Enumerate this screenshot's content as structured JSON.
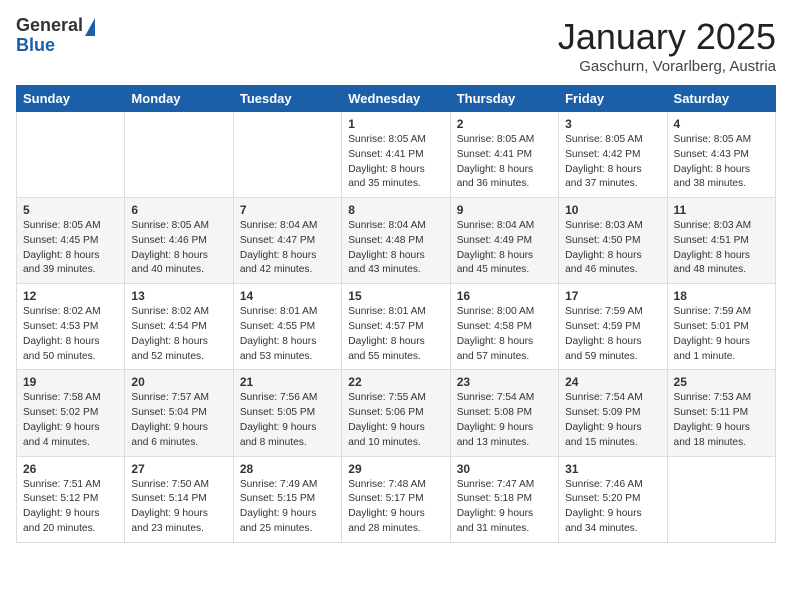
{
  "header": {
    "logo_general": "General",
    "logo_blue": "Blue",
    "month": "January 2025",
    "location": "Gaschurn, Vorarlberg, Austria"
  },
  "weekdays": [
    "Sunday",
    "Monday",
    "Tuesday",
    "Wednesday",
    "Thursday",
    "Friday",
    "Saturday"
  ],
  "weeks": [
    [
      {
        "day": "",
        "text": ""
      },
      {
        "day": "",
        "text": ""
      },
      {
        "day": "",
        "text": ""
      },
      {
        "day": "1",
        "text": "Sunrise: 8:05 AM\nSunset: 4:41 PM\nDaylight: 8 hours and 35 minutes."
      },
      {
        "day": "2",
        "text": "Sunrise: 8:05 AM\nSunset: 4:41 PM\nDaylight: 8 hours and 36 minutes."
      },
      {
        "day": "3",
        "text": "Sunrise: 8:05 AM\nSunset: 4:42 PM\nDaylight: 8 hours and 37 minutes."
      },
      {
        "day": "4",
        "text": "Sunrise: 8:05 AM\nSunset: 4:43 PM\nDaylight: 8 hours and 38 minutes."
      }
    ],
    [
      {
        "day": "5",
        "text": "Sunrise: 8:05 AM\nSunset: 4:45 PM\nDaylight: 8 hours and 39 minutes."
      },
      {
        "day": "6",
        "text": "Sunrise: 8:05 AM\nSunset: 4:46 PM\nDaylight: 8 hours and 40 minutes."
      },
      {
        "day": "7",
        "text": "Sunrise: 8:04 AM\nSunset: 4:47 PM\nDaylight: 8 hours and 42 minutes."
      },
      {
        "day": "8",
        "text": "Sunrise: 8:04 AM\nSunset: 4:48 PM\nDaylight: 8 hours and 43 minutes."
      },
      {
        "day": "9",
        "text": "Sunrise: 8:04 AM\nSunset: 4:49 PM\nDaylight: 8 hours and 45 minutes."
      },
      {
        "day": "10",
        "text": "Sunrise: 8:03 AM\nSunset: 4:50 PM\nDaylight: 8 hours and 46 minutes."
      },
      {
        "day": "11",
        "text": "Sunrise: 8:03 AM\nSunset: 4:51 PM\nDaylight: 8 hours and 48 minutes."
      }
    ],
    [
      {
        "day": "12",
        "text": "Sunrise: 8:02 AM\nSunset: 4:53 PM\nDaylight: 8 hours and 50 minutes."
      },
      {
        "day": "13",
        "text": "Sunrise: 8:02 AM\nSunset: 4:54 PM\nDaylight: 8 hours and 52 minutes."
      },
      {
        "day": "14",
        "text": "Sunrise: 8:01 AM\nSunset: 4:55 PM\nDaylight: 8 hours and 53 minutes."
      },
      {
        "day": "15",
        "text": "Sunrise: 8:01 AM\nSunset: 4:57 PM\nDaylight: 8 hours and 55 minutes."
      },
      {
        "day": "16",
        "text": "Sunrise: 8:00 AM\nSunset: 4:58 PM\nDaylight: 8 hours and 57 minutes."
      },
      {
        "day": "17",
        "text": "Sunrise: 7:59 AM\nSunset: 4:59 PM\nDaylight: 8 hours and 59 minutes."
      },
      {
        "day": "18",
        "text": "Sunrise: 7:59 AM\nSunset: 5:01 PM\nDaylight: 9 hours and 1 minute."
      }
    ],
    [
      {
        "day": "19",
        "text": "Sunrise: 7:58 AM\nSunset: 5:02 PM\nDaylight: 9 hours and 4 minutes."
      },
      {
        "day": "20",
        "text": "Sunrise: 7:57 AM\nSunset: 5:04 PM\nDaylight: 9 hours and 6 minutes."
      },
      {
        "day": "21",
        "text": "Sunrise: 7:56 AM\nSunset: 5:05 PM\nDaylight: 9 hours and 8 minutes."
      },
      {
        "day": "22",
        "text": "Sunrise: 7:55 AM\nSunset: 5:06 PM\nDaylight: 9 hours and 10 minutes."
      },
      {
        "day": "23",
        "text": "Sunrise: 7:54 AM\nSunset: 5:08 PM\nDaylight: 9 hours and 13 minutes."
      },
      {
        "day": "24",
        "text": "Sunrise: 7:54 AM\nSunset: 5:09 PM\nDaylight: 9 hours and 15 minutes."
      },
      {
        "day": "25",
        "text": "Sunrise: 7:53 AM\nSunset: 5:11 PM\nDaylight: 9 hours and 18 minutes."
      }
    ],
    [
      {
        "day": "26",
        "text": "Sunrise: 7:51 AM\nSunset: 5:12 PM\nDaylight: 9 hours and 20 minutes."
      },
      {
        "day": "27",
        "text": "Sunrise: 7:50 AM\nSunset: 5:14 PM\nDaylight: 9 hours and 23 minutes."
      },
      {
        "day": "28",
        "text": "Sunrise: 7:49 AM\nSunset: 5:15 PM\nDaylight: 9 hours and 25 minutes."
      },
      {
        "day": "29",
        "text": "Sunrise: 7:48 AM\nSunset: 5:17 PM\nDaylight: 9 hours and 28 minutes."
      },
      {
        "day": "30",
        "text": "Sunrise: 7:47 AM\nSunset: 5:18 PM\nDaylight: 9 hours and 31 minutes."
      },
      {
        "day": "31",
        "text": "Sunrise: 7:46 AM\nSunset: 5:20 PM\nDaylight: 9 hours and 34 minutes."
      },
      {
        "day": "",
        "text": ""
      }
    ]
  ]
}
